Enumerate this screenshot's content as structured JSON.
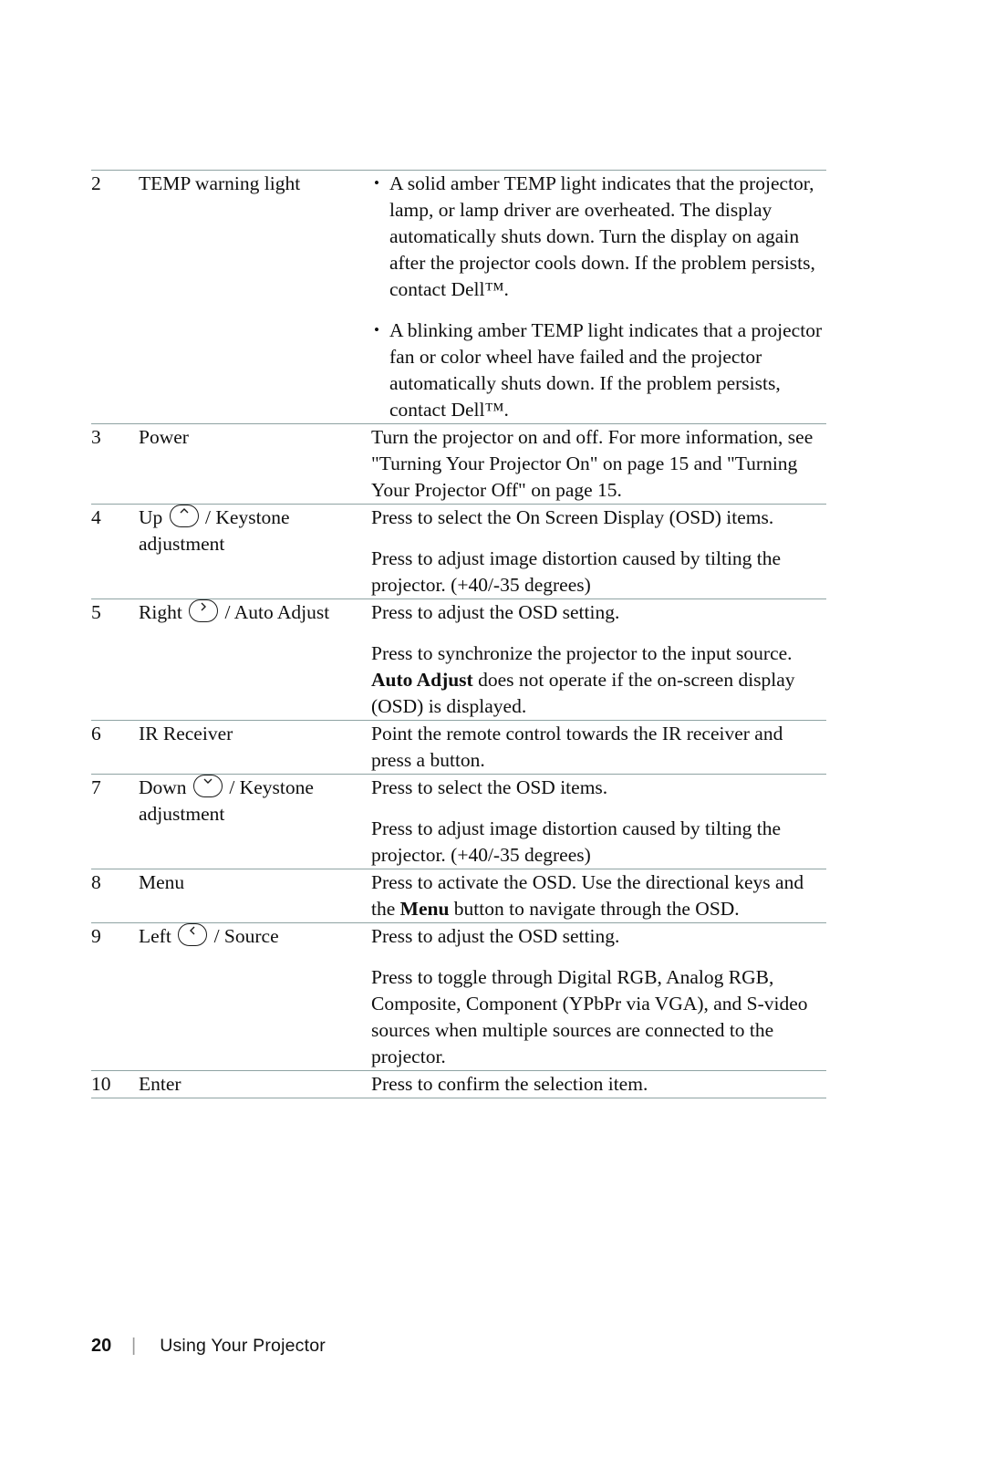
{
  "document": {
    "rows": [
      {
        "num": "2",
        "name": "TEMP warning light",
        "bullets": [
          "A solid amber TEMP light indicates that the projector, lamp, or lamp driver are overheated. The display automatically shuts down. Turn the display on again after the projector cools down. If the problem persists, contact Dell™.",
          "A blinking amber TEMP light indicates that a projector fan or color wheel have failed and the projector automatically shuts down. If the problem persists, contact Dell™."
        ]
      },
      {
        "num": "3",
        "name": "Power",
        "paragraphs": [
          "Turn the projector on and off. For more information, see \"Turning Your Projector On\" on page 15 and \"Turning Your Projector Off\" on page 15."
        ]
      },
      {
        "num": "4",
        "name_prefix": "Up",
        "name_icon": "chevron-up-icon",
        "name_suffix": "/ Keystone adjustment",
        "paragraphs": [
          "Press to select the On Screen Display (OSD) items.",
          "Press to adjust image distortion caused by tilting the projector. (+40/-35 degrees)"
        ]
      },
      {
        "num": "5",
        "name_prefix": "Right",
        "name_icon": "chevron-right-icon",
        "name_suffix": "/ Auto Adjust",
        "paragraphs": [
          "Press to adjust the OSD setting.",
          "Press to synchronize the projector to the input source. {Auto Adjust} does not operate if the on-screen display (OSD) is displayed."
        ]
      },
      {
        "num": "6",
        "name": "IR Receiver",
        "paragraphs": [
          "Point the remote control towards the IR receiver and press a button."
        ]
      },
      {
        "num": "7",
        "name_prefix": "Down",
        "name_icon": "chevron-down-icon",
        "name_suffix": "/ Keystone adjustment",
        "paragraphs": [
          "Press to select the OSD items.",
          "Press to adjust image distortion caused by tilting the projector. (+40/-35 degrees)"
        ]
      },
      {
        "num": "8",
        "name": "Menu",
        "paragraphs": [
          "Press to activate the OSD. Use the directional keys and the {Menu} button to navigate through the OSD."
        ]
      },
      {
        "num": "9",
        "name_prefix": "Left",
        "name_icon": "chevron-left-icon",
        "name_suffix": "/ Source",
        "paragraphs": [
          "Press to adjust the OSD setting.",
          "Press to toggle through Digital RGB, Analog RGB, Composite, Component (YPbPr via VGA), and S-video sources when multiple sources are connected to the projector."
        ]
      },
      {
        "num": "10",
        "name": "Enter",
        "paragraphs": [
          "Press to confirm the selection item."
        ]
      }
    ]
  },
  "footer": {
    "page_number": "20",
    "separator": "|",
    "title": "Using Your Projector"
  }
}
